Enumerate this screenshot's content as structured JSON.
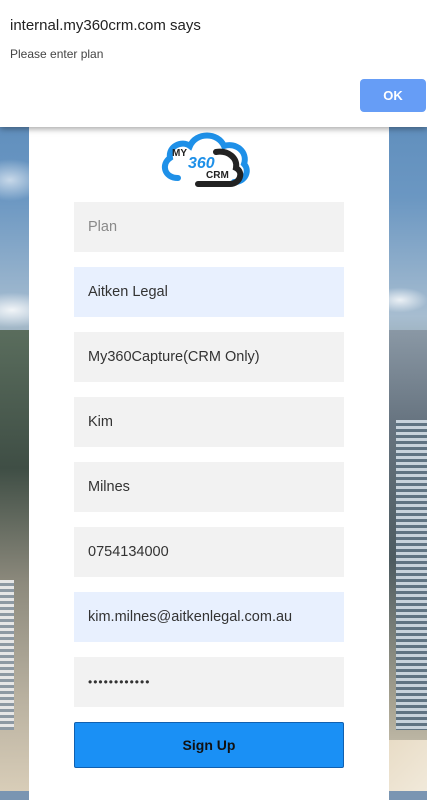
{
  "dialog": {
    "title": "internal.my360crm.com says",
    "message": "Please enter plan",
    "ok_label": "OK"
  },
  "logo": {
    "line1": "MY",
    "line2": "360",
    "line3": "CRM",
    "colors": {
      "cloud_blue": "#1e90e8",
      "cloud_dark": "#222222"
    }
  },
  "form": {
    "plan": {
      "placeholder": "Plan",
      "value": ""
    },
    "company": {
      "value": "Aitken Legal"
    },
    "product": {
      "value": "My360Capture(CRM Only)"
    },
    "first_name": {
      "value": "Kim"
    },
    "last_name": {
      "value": "Milnes"
    },
    "phone": {
      "value": "0754134000"
    },
    "email": {
      "value": "kim.milnes@aitkenlegal.com.au"
    },
    "password": {
      "value": "••••••••••••"
    },
    "submit_label": "Sign Up"
  },
  "colors": {
    "accent": "#1a90f5",
    "dialog_button": "#669df6",
    "field_bg": "#f2f2f2",
    "autofill_bg": "#e8f0fe"
  }
}
